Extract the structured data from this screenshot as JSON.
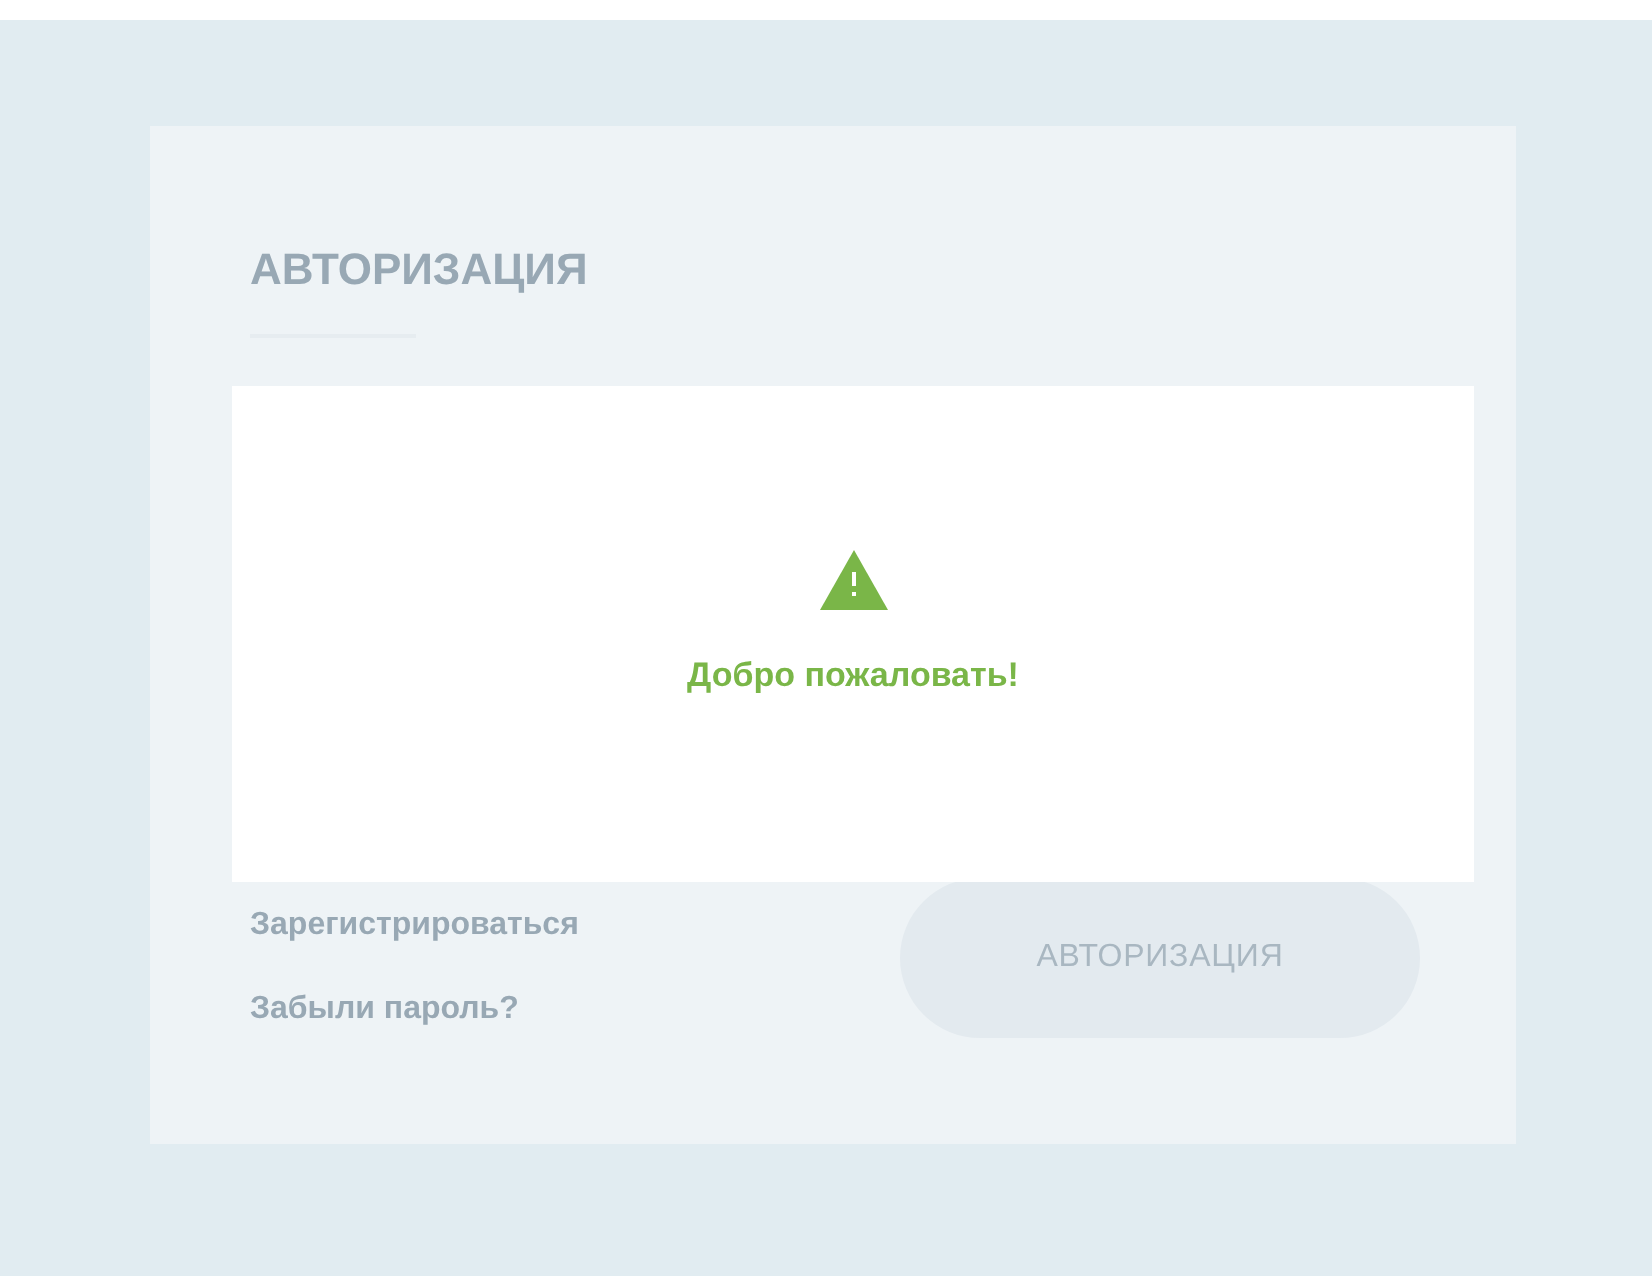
{
  "form": {
    "title": "АВТОРИЗАЦИЯ",
    "links": [
      "Зарегистрироваться",
      "Забыли пароль?"
    ],
    "submit": "АВТОРИЗАЦИЯ"
  },
  "popup": {
    "message": "Добро пожаловать!"
  }
}
